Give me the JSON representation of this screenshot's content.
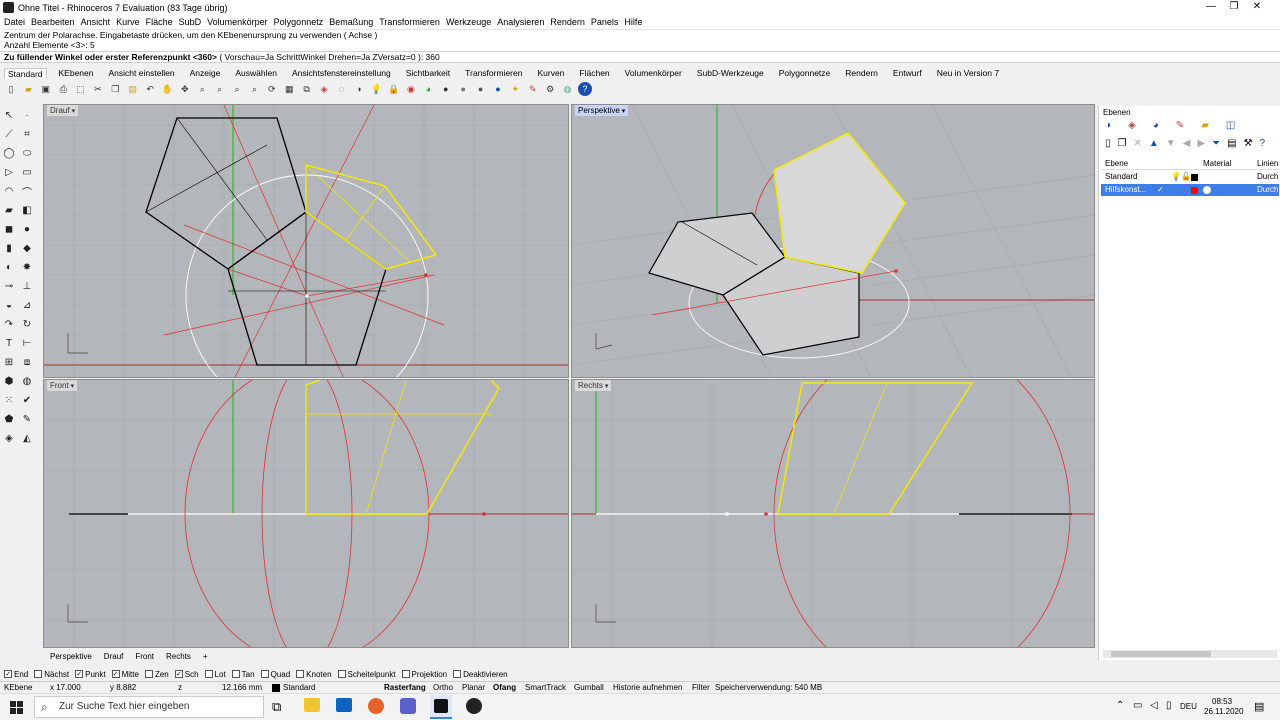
{
  "titlebar": {
    "title": "Ohne Titel - Rhinoceros 7 Evaluation (83 Tage übrig)",
    "minimize": "—",
    "maximize": "❐",
    "close": "✕"
  },
  "menu": [
    "Datei",
    "Bearbeiten",
    "Ansicht",
    "Kurve",
    "Fläche",
    "SubD",
    "Volumenkörper",
    "Polygonnetz",
    "Bemaßung",
    "Transformieren",
    "Werkzeuge",
    "Analysieren",
    "Rendern",
    "Panels",
    "Hilfe"
  ],
  "command_history": [
    "Zentrum der Polarachse. Eingabetaste drücken, um den KEbenenursprung zu verwenden ( Achse )",
    "Anzahl Elemente <3>: 5"
  ],
  "command_prompt": {
    "prompt": "Zu füllender Winkel oder erster Referenzpunkt <360>",
    "options": "( Vorschau=Ja  SchrittWinkel  Drehen=Ja  ZVersatz=0 ): 360"
  },
  "tabs": [
    "Standard",
    "KEbenen",
    "Ansicht einstellen",
    "Anzeige",
    "Auswählen",
    "Ansichtsfenstereinstellung",
    "Sichtbarkeit",
    "Transformieren",
    "Kurven",
    "Flächen",
    "Volumenkörper",
    "SubD-Werkzeuge",
    "Polygonnetze",
    "Rendern",
    "Entwurf",
    "Neu in Version 7"
  ],
  "viewports": {
    "top": "Drauf",
    "perspective": "Perspektive",
    "front": "Front",
    "right": "Rechts"
  },
  "viewport_tabs": [
    "Perspektive",
    "Drauf",
    "Front",
    "Rechts",
    "+"
  ],
  "osnap": [
    {
      "label": "End",
      "checked": true
    },
    {
      "label": "Nächst",
      "checked": false
    },
    {
      "label": "Punkt",
      "checked": true
    },
    {
      "label": "Mitte",
      "checked": true
    },
    {
      "label": "Zen",
      "checked": false
    },
    {
      "label": "Sch",
      "checked": true
    },
    {
      "label": "Lot",
      "checked": false
    },
    {
      "label": "Tan",
      "checked": false
    },
    {
      "label": "Quad",
      "checked": false
    },
    {
      "label": "Knoten",
      "checked": false
    },
    {
      "label": "Scheitelpunkt",
      "checked": false
    },
    {
      "label": "Projektion",
      "checked": false
    },
    {
      "label": "Deaktivieren",
      "checked": false
    }
  ],
  "status": {
    "cplane": "KEbene",
    "x": "x 17.000",
    "y": "y 8.882",
    "z": "z",
    "dist": "12.166 mm",
    "layer": "Standard",
    "grid_snap": "Rasterfang",
    "ortho": "Ortho",
    "planar": "Planar",
    "osnap": "Ofang",
    "smarttrack": "SmartTrack",
    "gumball": "Gumball",
    "history": "Historie aufnehmen",
    "filter": "Filter",
    "memory": "Speicherverwendung: 540 MB"
  },
  "layers": {
    "title": "Ebenen",
    "col_layer": "Ebene",
    "col_material": "Material",
    "col_linetype": "Linien",
    "rows": [
      {
        "name": "Standard",
        "material": "Durch",
        "color": "#000000",
        "selected": false
      },
      {
        "name": "Hilfskonst...",
        "material": "Durch",
        "color": "#ff0000",
        "selected": true
      }
    ]
  },
  "taskbar": {
    "search_placeholder": "Zur Suche Text hier eingeben",
    "lang": "DEU",
    "time": "08:53",
    "date": "26.11.2020"
  },
  "colors": {
    "viewport_bg": "#b3b6ba",
    "curve_yellow": "#f5e900",
    "construction_red": "#e03030",
    "selected_layer": "#3d7ee6"
  }
}
